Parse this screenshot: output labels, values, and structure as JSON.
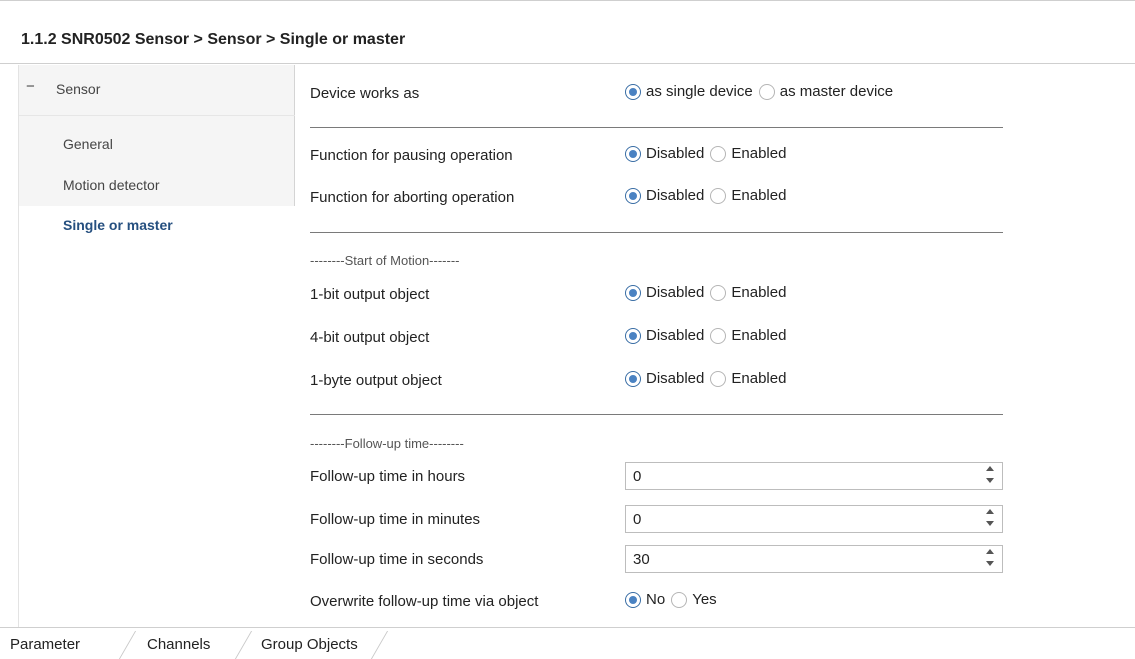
{
  "header": {
    "breadcrumb": "1.1.2 SNR0502 Sensor > Sensor > Single or master"
  },
  "sidebar": {
    "root": {
      "collapse_symbol": "−",
      "label": "Sensor"
    },
    "items": [
      {
        "label": "General",
        "active": false
      },
      {
        "label": "Motion detector",
        "active": false
      },
      {
        "label": "Single or master",
        "active": true
      }
    ]
  },
  "params": {
    "device_works_as": {
      "label": "Device works as",
      "options": [
        "as single device",
        "as master device"
      ],
      "selected": 0
    },
    "pausing": {
      "label": "Function for pausing operation",
      "options": [
        "Disabled",
        "Enabled"
      ],
      "selected": 0
    },
    "aborting": {
      "label": "Function for aborting operation",
      "options": [
        "Disabled",
        "Enabled"
      ],
      "selected": 0
    },
    "section_start": "--------Start of Motion-------",
    "obj_1bit": {
      "label": "1-bit output object",
      "options": [
        "Disabled",
        "Enabled"
      ],
      "selected": 0
    },
    "obj_4bit": {
      "label": "4-bit output object",
      "options": [
        "Disabled",
        "Enabled"
      ],
      "selected": 0
    },
    "obj_1byte": {
      "label": "1-byte output object",
      "options": [
        "Disabled",
        "Enabled"
      ],
      "selected": 0
    },
    "section_follow": "--------Follow-up time--------",
    "hours": {
      "label": "Follow-up time in hours",
      "value": "0"
    },
    "minutes": {
      "label": "Follow-up time in minutes",
      "value": "0"
    },
    "seconds": {
      "label": "Follow-up time in seconds",
      "value": "30"
    },
    "overwrite": {
      "label": "Overwrite follow-up time via object",
      "options": [
        "No",
        "Yes"
      ],
      "selected": 0
    }
  },
  "tabs": [
    "Parameter",
    "Channels",
    "Group Objects"
  ],
  "colors": {
    "accent": "#4a82c2",
    "active_text": "#254f7f",
    "sidebar_bg": "#f5f5f5"
  }
}
